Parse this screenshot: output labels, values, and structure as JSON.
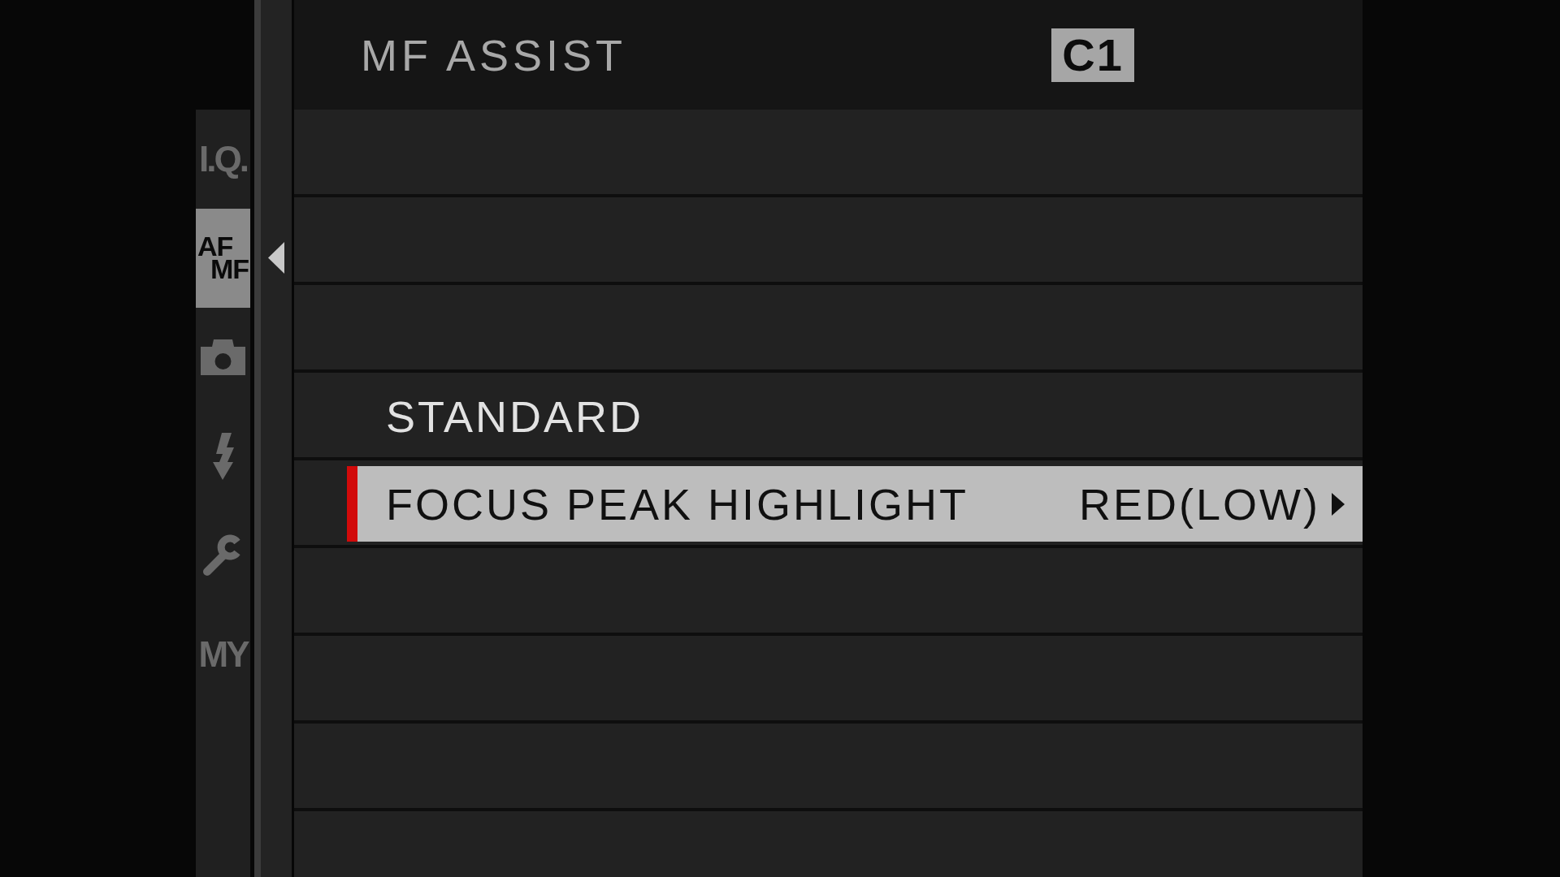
{
  "sidebar": {
    "tabs": [
      {
        "kind": "text",
        "label": "I.Q.",
        "selected": false
      },
      {
        "kind": "stacked",
        "lines": [
          "AF",
          "MF"
        ],
        "selected": true
      },
      {
        "kind": "shooting",
        "selected": false
      },
      {
        "kind": "flash",
        "selected": false
      },
      {
        "kind": "setup",
        "selected": false
      },
      {
        "kind": "text",
        "label": "MY",
        "selected": false
      }
    ]
  },
  "header": {
    "title": "MF ASSIST",
    "badge": "C1"
  },
  "menu": {
    "rows": [
      {
        "kind": "blank",
        "selected": false
      },
      {
        "kind": "blank",
        "selected": false
      },
      {
        "kind": "blank",
        "selected": false
      },
      {
        "kind": "option",
        "label": "STANDARD",
        "selected": false
      },
      {
        "kind": "option",
        "label": "FOCUS PEAK HIGHLIGHT",
        "value": "RED(LOW)",
        "selected": true
      },
      {
        "kind": "blank",
        "selected": false
      },
      {
        "kind": "blank",
        "selected": false
      },
      {
        "kind": "blank",
        "selected": false
      },
      {
        "kind": "blank",
        "selected": false
      }
    ]
  }
}
